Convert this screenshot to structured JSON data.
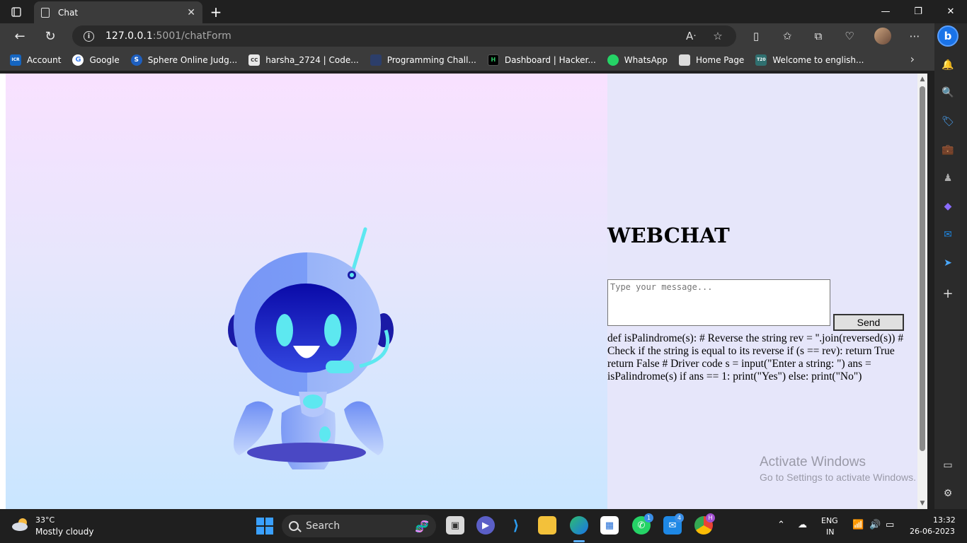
{
  "browser": {
    "tab_title": "Chat",
    "url_host": "127.0.0.1",
    "url_path": ":5001/chatForm"
  },
  "bookmarks": [
    {
      "label": "Account",
      "icon": "icr-icon",
      "color": "#1565c0",
      "glyph": "ICR"
    },
    {
      "label": "Google",
      "icon": "google-icon",
      "color": "#ffffff",
      "glyph": "G"
    },
    {
      "label": "Sphere Online Judg...",
      "icon": "spoj-icon",
      "color": "#1e5fbf",
      "glyph": "S"
    },
    {
      "label": "harsha_2724 | Code...",
      "icon": "codechef-icon",
      "color": "#e8e8e8",
      "glyph": "CC"
    },
    {
      "label": "Programming Chall...",
      "icon": "hackerearth-icon",
      "color": "#2c3e6a",
      "glyph": ""
    },
    {
      "label": "Dashboard | Hacker...",
      "icon": "hackerrank-icon",
      "color": "#000000",
      "glyph": "H"
    },
    {
      "label": "WhatsApp",
      "icon": "whatsapp-icon",
      "color": "#25d366",
      "glyph": ""
    },
    {
      "label": "Home Page",
      "icon": "page-icon",
      "color": "#dcdcdc",
      "glyph": ""
    },
    {
      "label": "Welcome to english...",
      "icon": "t20-icon",
      "color": "#2f6f6f",
      "glyph": "T20"
    }
  ],
  "page": {
    "title": "WEBCHAT",
    "input_placeholder": "Type your message...",
    "send_label": "Send",
    "response_text": "def isPalindrome(s): # Reverse the string rev = ''.join(reversed(s)) # Check if the string is equal to its reverse if (s == rev): return True return False # Driver code s = input(\"Enter a string: \") ans = isPalindrome(s) if ans == 1: print(\"Yes\") else: print(\"No\")"
  },
  "watermark": {
    "line1": "Activate Windows",
    "line2": "Go to Settings to activate Windows."
  },
  "taskbar": {
    "weather_temp": "33°C",
    "weather_desc": "Mostly cloudy",
    "search_label": "Search",
    "language_top": "ENG",
    "language_bottom": "IN",
    "time": "13:32",
    "date": "26-06-2023",
    "whatsapp_badge": "1",
    "store_badge": "4",
    "chrome_badge": "H"
  },
  "colors": {
    "left_gradient_top": "#f9e1ff",
    "left_gradient_bottom": "#c9e6ff",
    "right_panel": "#e6e6fa",
    "robot_body": "#7a9cf7",
    "robot_accent": "#5de8f0"
  }
}
